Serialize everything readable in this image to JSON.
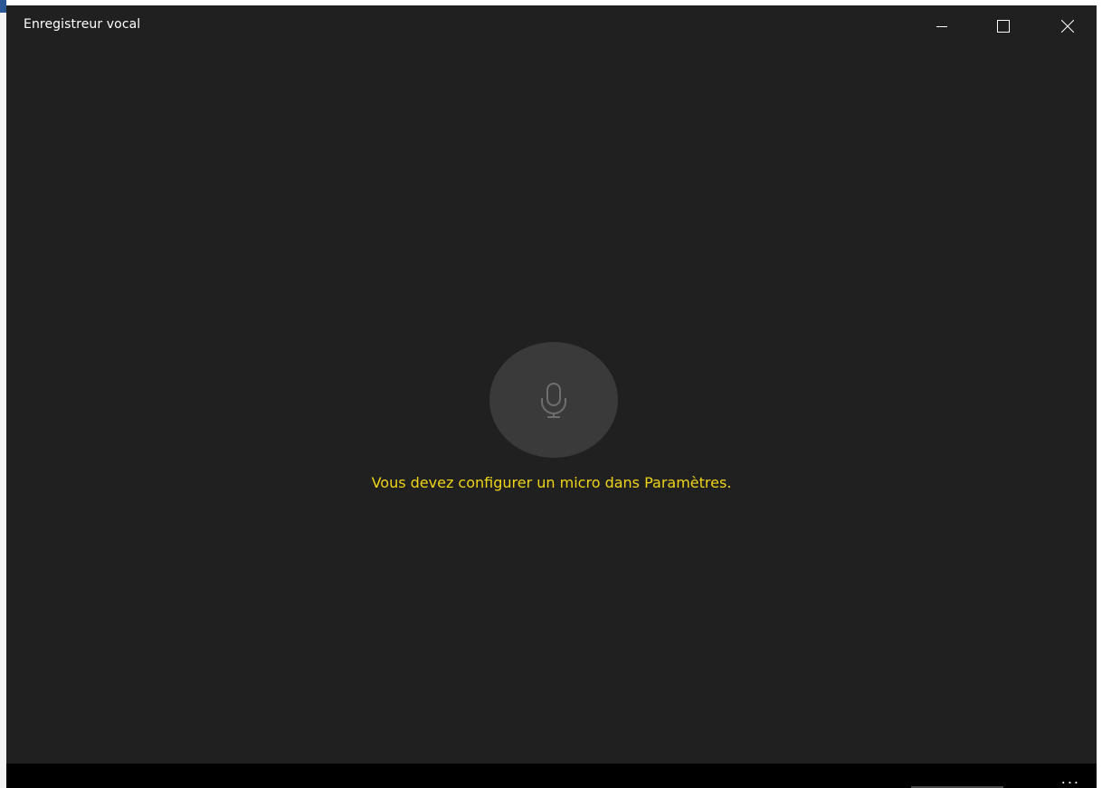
{
  "window": {
    "title": "Enregistreur vocal"
  },
  "caption_buttons": {
    "minimize_icon": "minimize-icon",
    "maximize_icon": "maximize-icon",
    "close_icon": "close-icon"
  },
  "main": {
    "mic_icon": "microphone-icon",
    "message": "Vous devez configurer un micro dans Paramètres."
  },
  "bottombar": {
    "more_label": "..."
  },
  "colors": {
    "background": "#202020",
    "warning_text": "#f0d41a",
    "mic_circle": "#3a3a3a",
    "mic_glyph": "#6e6e6e",
    "title_text": "#ffffff"
  }
}
